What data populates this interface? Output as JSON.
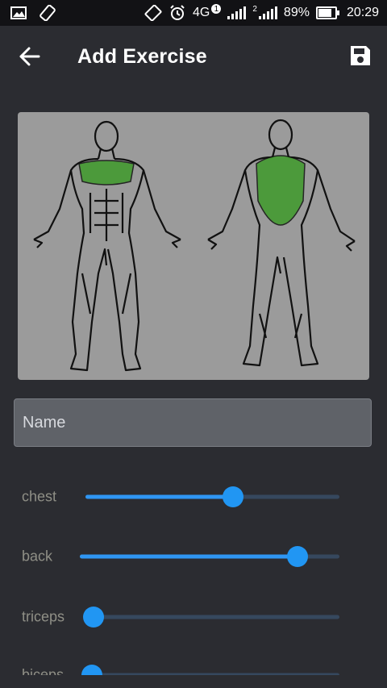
{
  "status_bar": {
    "network": "4G",
    "sim1": "1",
    "sim2": "2",
    "battery": "89%",
    "battery_level": 0.89,
    "time": "20:29",
    "icons": [
      "gallery-icon",
      "screen-rotation-icon",
      "auto-rotate-icon",
      "alarm-icon",
      "signal-icon",
      "battery-icon"
    ]
  },
  "app_bar": {
    "title": "Add Exercise",
    "back_icon": "arrow-back-icon",
    "save_icon": "save-icon"
  },
  "muscle_image": {
    "highlighted_muscles": [
      "chest",
      "back"
    ],
    "highlight_color": "#3f9a2b",
    "background_color": "#9b9b9b"
  },
  "name_field": {
    "placeholder": "Name",
    "value": ""
  },
  "sliders": [
    {
      "label": "chest",
      "value": 0.58
    },
    {
      "label": "back",
      "value": 0.84
    },
    {
      "label": "triceps",
      "value": 0.0
    },
    {
      "label": "biceps",
      "value": 0.0
    }
  ],
  "accent_color": "#2196f3"
}
